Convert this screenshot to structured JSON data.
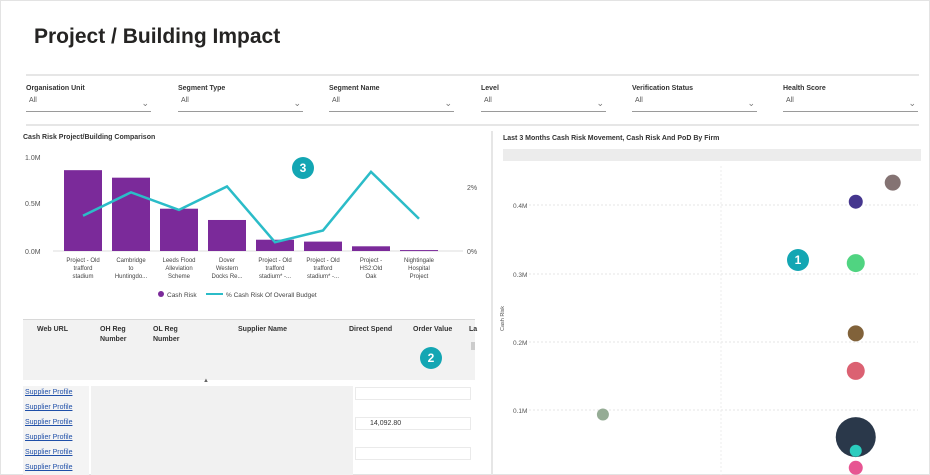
{
  "page": {
    "title": "Project / Building Impact"
  },
  "slicers": [
    {
      "label": "Organisation Unit",
      "value": "All"
    },
    {
      "label": "Segment Type",
      "value": "All"
    },
    {
      "label": "Segment Name",
      "value": "All"
    },
    {
      "label": "Level",
      "value": "All"
    },
    {
      "label": "Verification Status",
      "value": "All"
    },
    {
      "label": "Health Score",
      "value": "All"
    }
  ],
  "badges": {
    "one": "1",
    "two": "2",
    "three": "3"
  },
  "bar_chart": {
    "title": "Cash Risk Project/Building Comparison",
    "y_ticks": [
      "1.0M",
      "0.5M",
      "0.0M"
    ],
    "y2_ticks": [
      "2%",
      "0%"
    ],
    "legend": {
      "bar": "Cash Risk",
      "line": "% Cash Risk Of Overall Budget"
    },
    "colors": {
      "bar": "#7b2a9a",
      "line": "#2bbcc8"
    }
  },
  "scatter": {
    "title": "Last 3 Months Cash Risk Movement, Cash Risk And PoD By Firm",
    "y_label": "Cash Risk",
    "y_ticks": [
      "0.4M",
      "0.3M",
      "0.2M",
      "0.1M"
    ]
  },
  "chart_data": [
    {
      "type": "bar",
      "title": "Cash Risk Project/Building Comparison",
      "categories": [
        [
          "Project - Old",
          "trafford",
          "stadium"
        ],
        [
          "Cambridge",
          "to",
          "Huntingdo..."
        ],
        [
          "Leeds Flood",
          "Alleviation",
          "Scheme"
        ],
        [
          "Dover",
          "Western",
          "Docks Re..."
        ],
        [
          "Project - Old",
          "trafford",
          "stadium* -..."
        ],
        [
          "Project - Old",
          "trafford",
          "stadium* -..."
        ],
        [
          "Project -",
          "HS2:Old",
          "Oak"
        ],
        [
          "Nightingale",
          "Hospital",
          "Project"
        ]
      ],
      "series": [
        {
          "name": "Cash Risk",
          "kind": "bar",
          "values": [
            0.86,
            0.78,
            0.45,
            0.33,
            0.12,
            0.1,
            0.05,
            0.01
          ]
        },
        {
          "name": "% Cash Risk Of Overall Budget",
          "kind": "line",
          "values": [
            1.2,
            2.0,
            1.4,
            2.2,
            0.3,
            0.7,
            2.7,
            1.1
          ]
        }
      ],
      "ylim": [
        0,
        1.0
      ],
      "y2lim": [
        0,
        3
      ]
    },
    {
      "type": "scatter",
      "title": "Last 3 Months Cash Risk Movement, Cash Risk And PoD By Firm",
      "ylabel": "Cash Risk",
      "ylim": [
        0,
        0.45
      ],
      "points": [
        {
          "x": 0.935,
          "y": 0.433,
          "r": 8,
          "color": "#7d6b6b"
        },
        {
          "x": 0.84,
          "y": 0.405,
          "r": 7,
          "color": "#3b2b88"
        },
        {
          "x": 0.84,
          "y": 0.315,
          "r": 9,
          "color": "#47d27a"
        },
        {
          "x": 0.84,
          "y": 0.212,
          "r": 8,
          "color": "#7a5a2f"
        },
        {
          "x": 0.84,
          "y": 0.157,
          "r": 9,
          "color": "#d9596a"
        },
        {
          "x": 0.84,
          "y": 0.06,
          "r": 20,
          "color": "#1f2d40"
        },
        {
          "x": 0.84,
          "y": 0.04,
          "r": 6,
          "color": "#2bd4c4"
        },
        {
          "x": 0.84,
          "y": 0.015,
          "r": 7,
          "color": "#e64c8c"
        },
        {
          "x": 0.19,
          "y": 0.093,
          "r": 6,
          "color": "#8fa88f"
        }
      ]
    }
  ],
  "table": {
    "headers": [
      "Web URL",
      "OH Reg Number",
      "OL Reg Number",
      "Supplier Name",
      "Direct Spend",
      "Order Value",
      "La"
    ],
    "rows": [
      {
        "link": "Supplier Profile",
        "spend": ""
      },
      {
        "link": "Supplier Profile",
        "spend": ""
      },
      {
        "link": "Supplier Profile",
        "spend": "14,092.80"
      },
      {
        "link": "Supplier Profile",
        "spend": ""
      },
      {
        "link": "Supplier Profile",
        "spend": ""
      },
      {
        "link": "Supplier Profile",
        "spend": ""
      }
    ]
  }
}
